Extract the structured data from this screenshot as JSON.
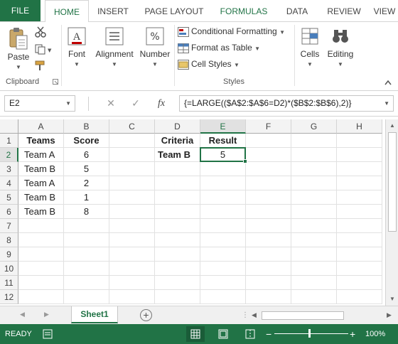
{
  "ribbon": {
    "tabs": [
      "FILE",
      "HOME",
      "INSERT",
      "PAGE LAYOUT",
      "FORMULAS",
      "DATA",
      "REVIEW",
      "VIEW"
    ],
    "active_tab": "HOME",
    "clipboard": {
      "paste": "Paste",
      "group": "Clipboard"
    },
    "font": "Font",
    "alignment": "Alignment",
    "number": "Number",
    "styles": {
      "conditional": "Conditional Formatting",
      "format_table": "Format as Table",
      "cell_styles": "Cell Styles",
      "group": "Styles"
    },
    "cells": "Cells",
    "editing": "Editing"
  },
  "formula_bar": {
    "name_box": "E2",
    "cancel": "✕",
    "enter": "✓",
    "fx": "fx",
    "formula": "{=LARGE(($A$2:$A$6=D2)*($B$2:$B$6),2)}"
  },
  "grid": {
    "columns": [
      "A",
      "B",
      "C",
      "D",
      "E",
      "F",
      "G",
      "H"
    ],
    "rows": [
      "1",
      "2",
      "3",
      "4",
      "5",
      "6",
      "7",
      "8",
      "9",
      "10",
      "11",
      "12"
    ],
    "selected_cell": "E2",
    "cells": {
      "A1": "Teams",
      "B1": "Score",
      "D1": "Criteria",
      "E1": "Result",
      "A2": "Team A",
      "B2": "6",
      "D2": "Team B",
      "E2": "5",
      "A3": "Team B",
      "B3": "5",
      "A4": "Team A",
      "B4": "2",
      "A5": "Team B",
      "B5": "1",
      "A6": "Team B",
      "B6": "8"
    }
  },
  "sheets": {
    "active": "Sheet1",
    "add": "+"
  },
  "status": {
    "mode": "READY",
    "zoom": "100%",
    "zoom_minus": "−",
    "zoom_plus": "+"
  },
  "colors": {
    "accent": "#217346"
  }
}
